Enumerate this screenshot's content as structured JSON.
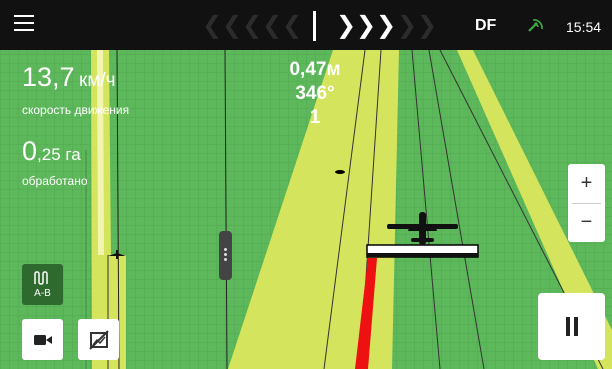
{
  "topbar": {
    "menu_icon": "hamburger-menu-icon",
    "lightbar": {
      "left_chevrons": [
        "❮",
        "❮",
        "❮",
        "❮",
        "❮"
      ],
      "right_chevrons_active": [
        "❯",
        "❯",
        "❯"
      ],
      "right_chevrons_inactive": [
        "❯",
        "❯"
      ]
    },
    "correction_source": "DF",
    "gps_icon": "satellite-signal-icon",
    "time": "15:54"
  },
  "stats": {
    "speed_value": "13,7",
    "speed_unit": "км/ч",
    "speed_label": "скорость движения",
    "area_value": "0",
    "area_decimals": ",25 га",
    "area_label": "обработано"
  },
  "guidance": {
    "offset": "0,47м",
    "heading": "346°",
    "line_number": "1"
  },
  "controls": {
    "zoom_in": "+",
    "zoom_out": "−",
    "ab_mode_label": "A-B",
    "ab_mode_icon": "ab-line-mode-icon",
    "camera_icon": "video-camera-icon",
    "map_off_icon": "map-off-icon",
    "pause_icon": "pause-icon"
  },
  "colors": {
    "field_green": "#5cb85a",
    "worked_strip": "#d4e45c",
    "track_red": "#ee1111",
    "topbar": "#111111"
  }
}
